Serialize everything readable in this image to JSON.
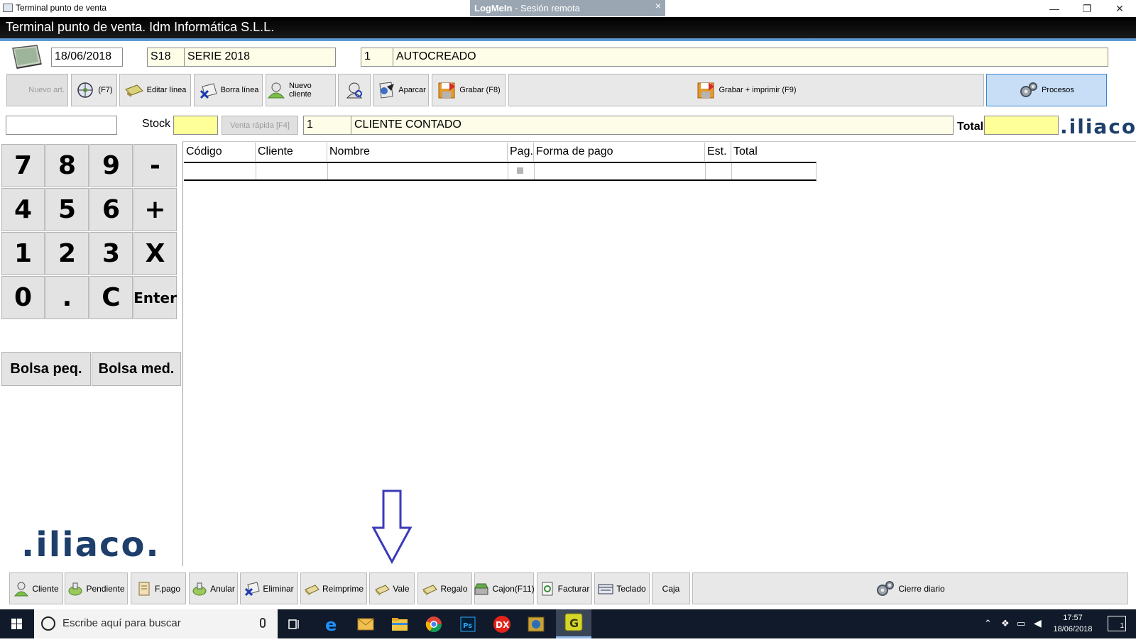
{
  "window": {
    "title": "Terminal punto de venta",
    "logmein_brand": "LogMeIn",
    "logmein_session": "Sesión remota",
    "logmein_close": "×",
    "min": "—",
    "restore": "❐",
    "close": "✕"
  },
  "header": {
    "title": "Terminal punto de venta. Idm Informática S.L.L."
  },
  "doc": {
    "date": "18/06/2018",
    "serie_code": "S18",
    "serie_name": "SERIE 2018",
    "number": "1",
    "state": "AUTOCREADO"
  },
  "toolbar": {
    "nuevo_art": "Nuevo art.",
    "f7": "(F7)",
    "editar_linea": "Editar línea",
    "borra_linea": "Borra línea",
    "nuevo_cliente": "Nuevo cliente",
    "aparcar": "Aparcar",
    "grabar": "Grabar (F8)",
    "grabar_imprimir": "Grabar + imprimir (F9)",
    "procesos": "Procesos"
  },
  "line": {
    "code_value": "",
    "stock_label": "Stock",
    "stock_value": "",
    "venta_rapida": "Venta rápida [F4]",
    "client_code": "1",
    "client_name": "CLIENTE CONTADO",
    "total_label": "Total",
    "total_value": ""
  },
  "brand": {
    "logo": ".iliaco."
  },
  "keypad": {
    "keys": [
      "7",
      "8",
      "9",
      "-",
      "4",
      "5",
      "6",
      "+",
      "1",
      "2",
      "3",
      "X",
      "0",
      ".",
      "C",
      "Enter"
    ],
    "bolsa_peq": "Bolsa peq.",
    "bolsa_med": "Bolsa med."
  },
  "grid": {
    "columns": [
      "Código",
      "Cliente",
      "Nombre",
      "Pag.",
      "Forma de pago",
      "Est.",
      "Total"
    ]
  },
  "bottom": {
    "cliente": "Cliente",
    "pendiente": "Pendiente",
    "fpago": "F.pago",
    "anular": "Anular",
    "eliminar": "Eliminar",
    "reimprime": "Reimprime",
    "vale": "Vale",
    "regalo": "Regalo",
    "cajon": "Cajon(F11)",
    "facturar": "Facturar",
    "teclado": "Teclado",
    "caja": "Caja",
    "cierre_diario": "Cierre diario"
  },
  "taskbar": {
    "search_placeholder": "Escribe aquí para buscar",
    "time": "17:57",
    "date": "18/06/2018",
    "notifications": "1"
  },
  "colors": {
    "field_bg": "#fefde7",
    "yellow_field": "#ffff99",
    "accent_blue": "#3b3bb8",
    "header_bg": "#000000"
  }
}
